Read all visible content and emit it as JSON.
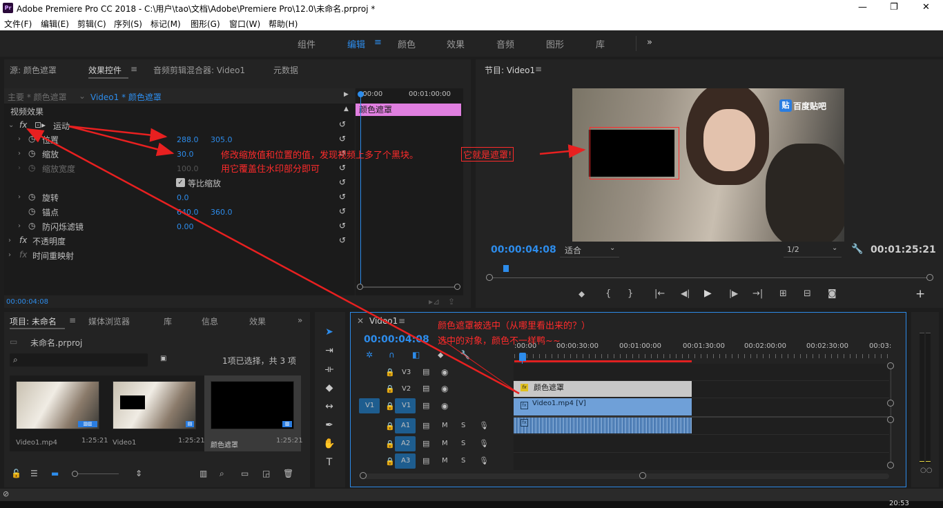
{
  "window": {
    "title": "Adobe Premiere Pro CC 2018 - C:\\用户\\tao\\文档\\Adobe\\Premiere Pro\\12.0\\未命名.prproj *",
    "logo": "Pr",
    "minimize": "—",
    "maximize": "❐",
    "close": "✕"
  },
  "menu": [
    "文件(F)",
    "编辑(E)",
    "剪辑(C)",
    "序列(S)",
    "标记(M)",
    "图形(G)",
    "窗口(W)",
    "帮助(H)"
  ],
  "workspaces": {
    "items": [
      "组件",
      "编辑",
      "颜色",
      "效果",
      "音频",
      "图形",
      "库"
    ],
    "active": "编辑",
    "more": "»"
  },
  "source_panel": {
    "tabs": [
      "源: 颜色遮罩",
      "效果控件",
      "音频剪辑混合器: Video1",
      "元数据"
    ],
    "active_tab": "效果控件",
    "master": "主要 * 颜色遮罩",
    "clip": "Video1 * 颜色遮罩",
    "section": "视频效果",
    "motion": "运动",
    "position_label": "位置",
    "position_x": "288.0",
    "position_y": "305.0",
    "scale_label": "缩放",
    "scale_value": "30.0",
    "scale_width_label": "缩放宽度",
    "scale_width_value": "100.0",
    "uniform_scale": "等比缩放",
    "rotation_label": "旋转",
    "rotation_value": "0.0",
    "anchor_label": "锚点",
    "anchor_x": "640.0",
    "anchor_y": "360.0",
    "flicker_label": "防闪烁滤镜",
    "flicker_value": "0.00",
    "opacity_label": "不透明度",
    "time_remap_label": "时间重映射",
    "timecode": "00:00:04:08",
    "mini_tc_start": ":00:00",
    "mini_tc_end": "00:01:00:00",
    "mini_clip": "颜色遮罩"
  },
  "program": {
    "title": "节目: Video1",
    "timecode": "00:00:04:08",
    "fit": "适合",
    "res": "1/2",
    "duration": "00:01:25:21",
    "watermark": "百度贴吧",
    "watermark_badge": "贴"
  },
  "annotations": {
    "note1_a": "修改缩放值和位置的值，发现视频上多了个黑块。",
    "note1_b": "它就是遮罩!",
    "note2": "用它覆盖住水印部分即可",
    "note3": "颜色遮罩被选中（从哪里看出来的？）",
    "note4": "选中的对象，颜色不一样鸭~~"
  },
  "project": {
    "tabs": [
      "项目: 未命名",
      "媒体浏览器",
      "库",
      "信息",
      "效果"
    ],
    "active_tab": "项目: 未命名",
    "file": "未命名.prproj",
    "selection": "1项已选择，共 3 项",
    "items": [
      {
        "name": "Video1.mp4",
        "dur": "1:25:21"
      },
      {
        "name": "Video1",
        "dur": "1:25:21"
      },
      {
        "name": "颜色遮罩",
        "dur": "1:25:21"
      }
    ]
  },
  "timeline": {
    "seq": "Video1",
    "timecode": "00:00:04:08",
    "ruler": [
      ":00:00",
      "00:00:30:00",
      "00:01:00:00",
      "00:01:30:00",
      "00:02:00:00",
      "00:02:30:00",
      "00:03:"
    ],
    "video_tracks": [
      "V3",
      "V2",
      "V1"
    ],
    "audio_tracks": [
      "A1",
      "A2",
      "A3"
    ],
    "src_v": "V1",
    "clip_v2": "颜色遮罩",
    "clip_v1": "Video1.mp4 [V]",
    "fx": "fx",
    "m": "M",
    "s": "S"
  },
  "meter": {
    "label": "○○"
  },
  "statusbar": {
    "time": "20:53"
  }
}
